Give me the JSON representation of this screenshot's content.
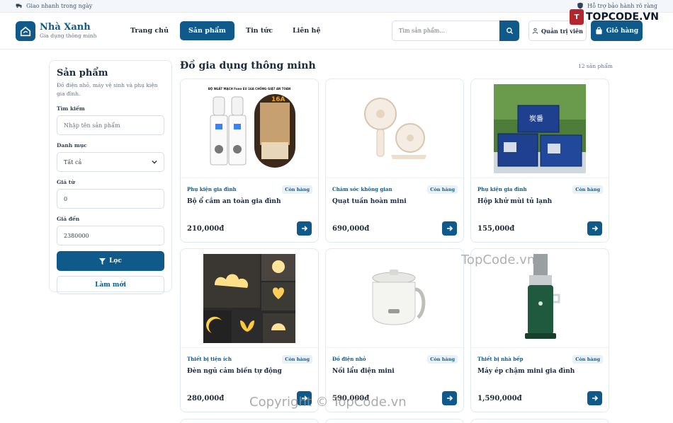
{
  "topbar": {
    "left_text": "Giao nhanh trong ngày",
    "right_text": "Hỗ trợ bảo hành rõ ràng"
  },
  "brand": {
    "name": "Nhà Xanh",
    "tagline": "Gia dụng thông minh"
  },
  "nav": [
    {
      "label": "Trang chủ",
      "active": false
    },
    {
      "label": "Sản phẩm",
      "active": true
    },
    {
      "label": "Tin tức",
      "active": false
    },
    {
      "label": "Liên hệ",
      "active": false
    }
  ],
  "search": {
    "placeholder": "Tìm sản phẩm..."
  },
  "admin_label": "Quản trị viên",
  "cart_label": "Giỏ hàng",
  "sidebar": {
    "title": "Sản phẩm",
    "description": "Đồ điện nhỏ, máy vệ sinh và phụ kiện gia đình.",
    "search_label": "Tìm kiếm",
    "search_placeholder": "Nhập tên sản phẩm",
    "category_label": "Danh mục",
    "category_value": "Tất cả",
    "price_from_label": "Giá từ",
    "price_from_value": "0",
    "price_to_label": "Giá đến",
    "price_to_value": "2380000",
    "filter_label": "Lọc",
    "reset_label": "Làm mới"
  },
  "main": {
    "title": "Đồ gia dụng thông minh",
    "count": "12 sản phẩm"
  },
  "products": [
    {
      "category": "Phụ kiện gia đình",
      "status": "Còn hàng",
      "name": "Bộ ổ cắm an toàn gia đình",
      "price": "210,000đ",
      "image_caption": "BỘ NGẮT MẠCH Fonn EU 16A CHỐNG GIẬT AN TOÀN",
      "image_tag": "16A"
    },
    {
      "category": "Chăm sóc không gian",
      "status": "Còn hàng",
      "name": "Quạt tuần hoàn mini",
      "price": "690,000đ"
    },
    {
      "category": "Phụ kiện gia đình",
      "status": "Còn hàng",
      "name": "Hộp khử mùi tủ lạnh",
      "price": "155,000đ",
      "image_label": "炭番"
    },
    {
      "category": "Thiết bị tiện ích",
      "status": "Còn hàng",
      "name": "Đèn ngủ cảm biến tự động",
      "price": "280,000đ"
    },
    {
      "category": "Đồ điện nhỏ",
      "status": "Còn hàng",
      "name": "Nồi lẩu điện mini",
      "price": "590,000đ"
    },
    {
      "category": "Thiết bị nhà bếp",
      "status": "Còn hàng",
      "name": "Máy ép chậm mini gia đình",
      "price": "1,590,000đ"
    }
  ],
  "watermark": {
    "logo_text": "TOPCODE.VN",
    "center_text": "TopCode.vn",
    "bottom_text": "Copyright © TopCode.vn"
  },
  "colors": {
    "primary": "#0f5a8a",
    "text": "#1e293b",
    "muted": "#64748b",
    "border": "#e3e9f0"
  }
}
